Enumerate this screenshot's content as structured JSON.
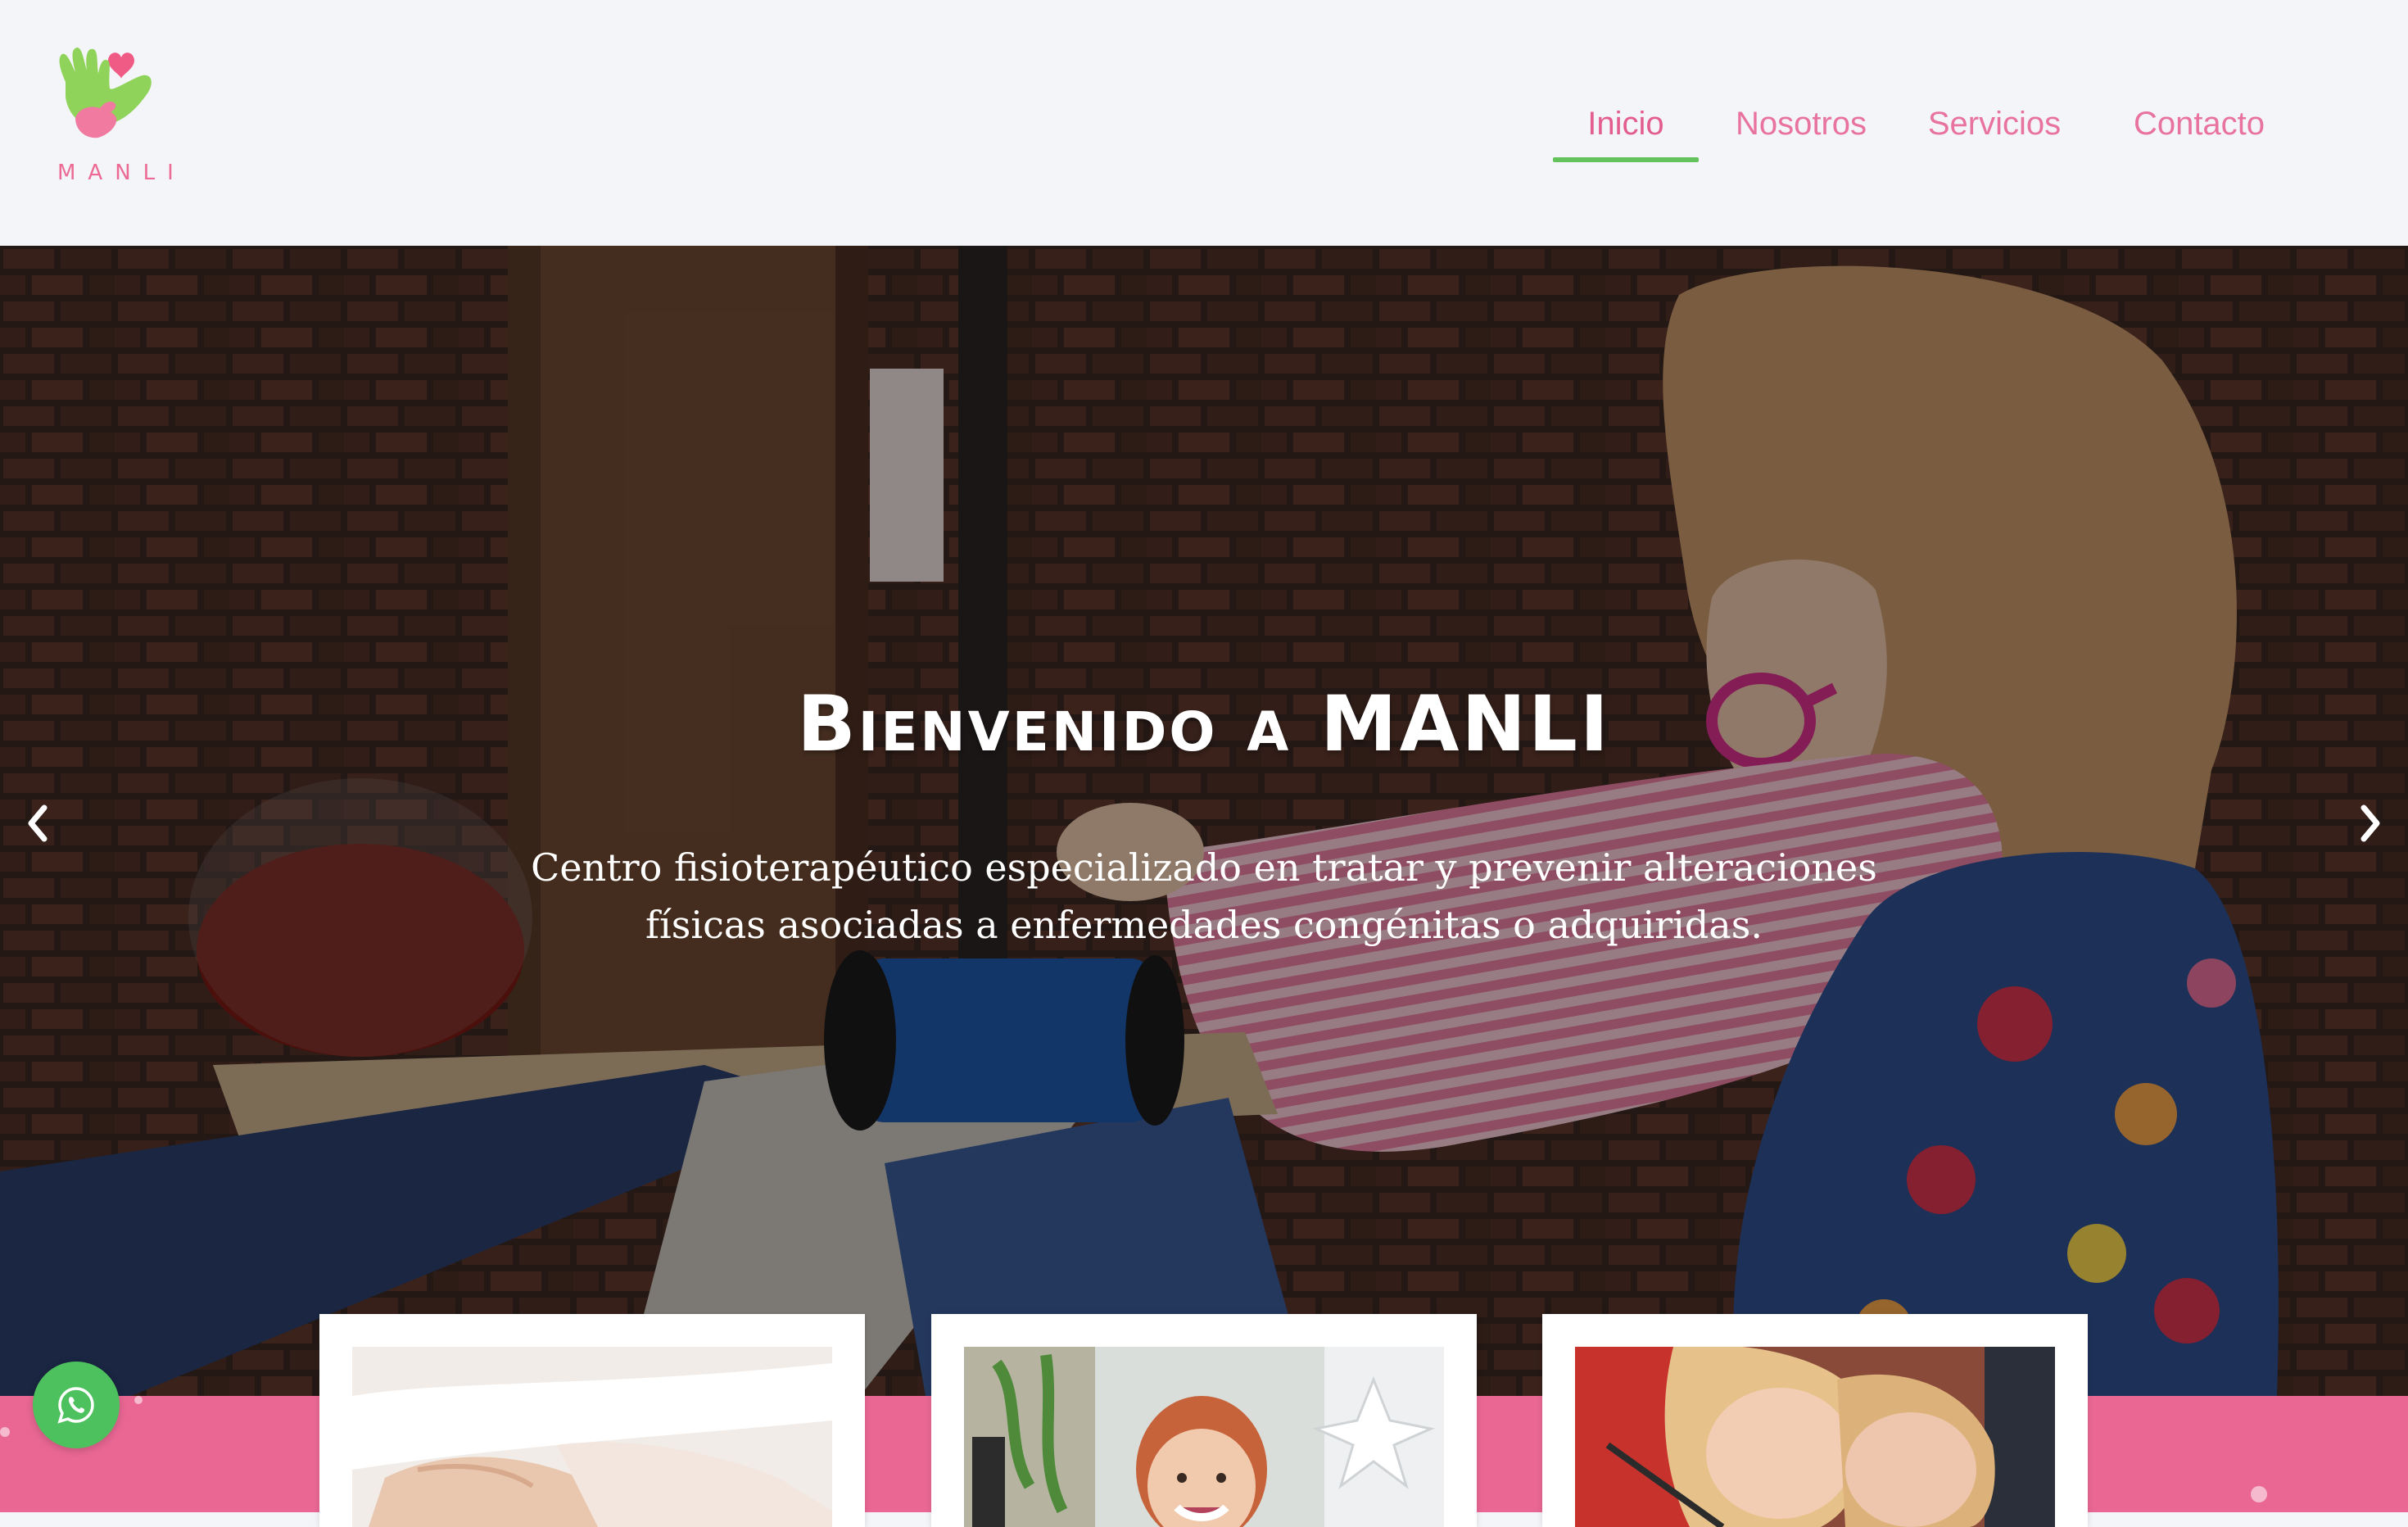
{
  "brand": {
    "name": "MANLI",
    "colors": {
      "pink": "#ea6794",
      "green": "#63c25b",
      "nav_text": "#e8739c"
    }
  },
  "nav": {
    "items": [
      {
        "label": "Inicio",
        "active": true
      },
      {
        "label": "Nosotros",
        "active": false
      },
      {
        "label": "Servicios",
        "active": false
      },
      {
        "label": "Contacto",
        "active": false
      }
    ]
  },
  "hero": {
    "title": "Bienvenido a MANLI",
    "subtitle": "Centro fisioterapéutico especializado en tratar y prevenir alteraciones físicas asociadas a enfermedades congénitas o adquiridas.",
    "prev_icon": "chevron-left-icon",
    "next_icon": "chevron-right-icon",
    "slides_total": 2,
    "active_slide": 1
  },
  "cards": [
    {
      "image": "hands-massage-photo"
    },
    {
      "image": "smiling-child-photo"
    },
    {
      "image": "children-drawing-photo"
    }
  ],
  "whatsapp": {
    "icon": "whatsapp-icon"
  }
}
